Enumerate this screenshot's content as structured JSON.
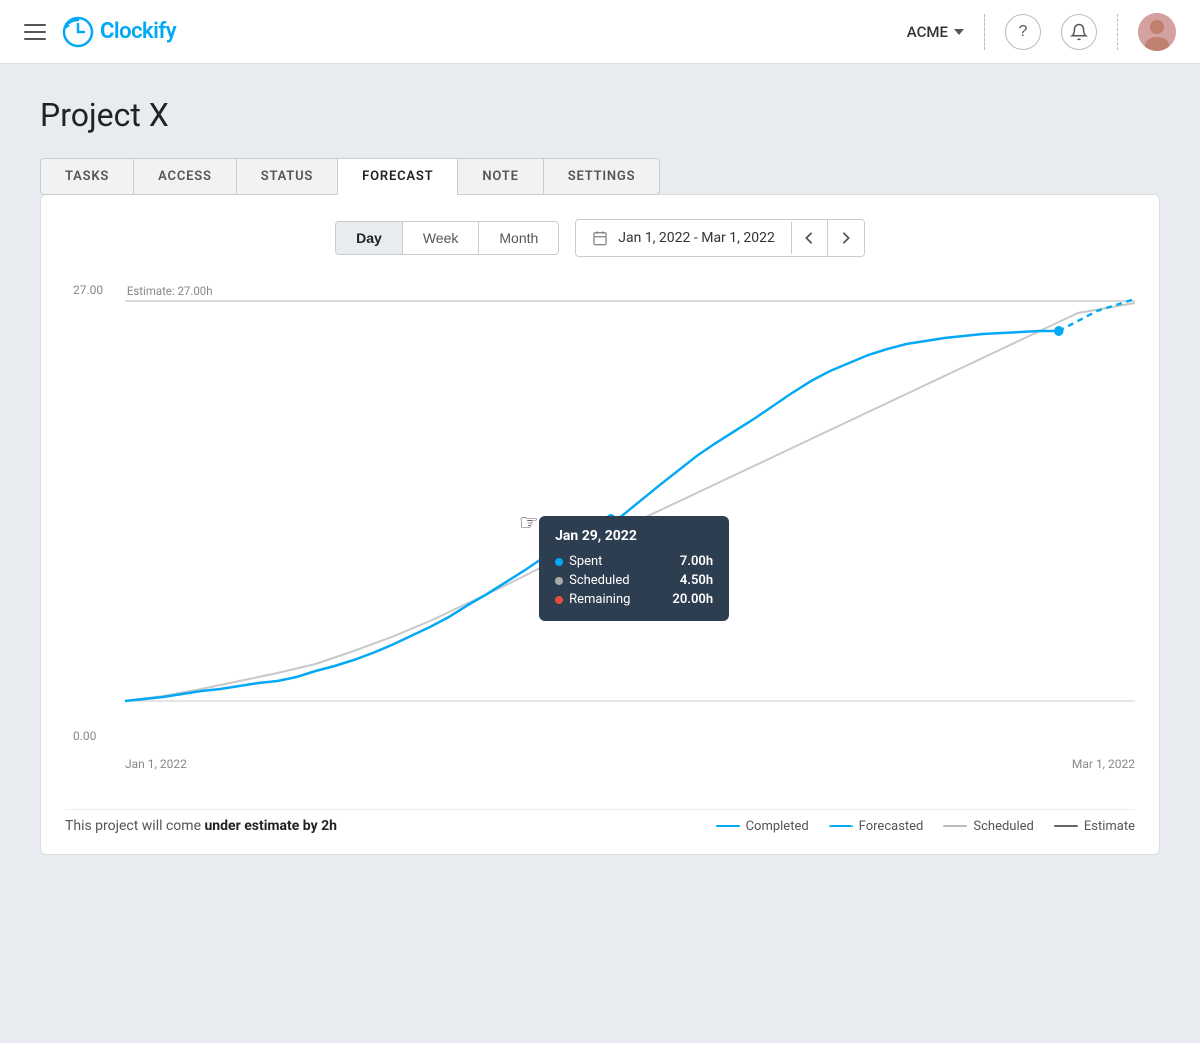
{
  "app": {
    "logo_text": "lockify",
    "workspace": "ACME"
  },
  "header": {
    "help_label": "?",
    "notification_label": "🔔"
  },
  "project": {
    "title": "Project X"
  },
  "tabs": {
    "items": [
      {
        "id": "tasks",
        "label": "TASKS"
      },
      {
        "id": "access",
        "label": "ACCESS"
      },
      {
        "id": "status",
        "label": "STATUS"
      },
      {
        "id": "forecast",
        "label": "FORECAST",
        "active": true
      },
      {
        "id": "note",
        "label": "NOTE"
      },
      {
        "id": "settings",
        "label": "SETTINGS"
      }
    ]
  },
  "chart": {
    "period_buttons": [
      {
        "id": "day",
        "label": "Day",
        "active": true
      },
      {
        "id": "week",
        "label": "Week",
        "active": false
      },
      {
        "id": "month",
        "label": "Month",
        "active": false
      }
    ],
    "date_range": "Jan 1, 2022 - Mar 1, 2022",
    "y_top": "27.00",
    "y_bottom": "0.00",
    "estimate_label": "Estimate: 27.00h",
    "x_left": "Jan 1, 2022",
    "x_right": "Mar 1, 2022",
    "tooltip": {
      "date": "Jan 29, 2022",
      "rows": [
        {
          "id": "spent",
          "label": "Spent",
          "value": "7.00h",
          "dot": "blue"
        },
        {
          "id": "scheduled",
          "label": "Scheduled",
          "value": "4.50h",
          "dot": "gray"
        },
        {
          "id": "remaining",
          "label": "Remaining",
          "value": "20.00h",
          "dot": "red"
        }
      ]
    },
    "footer": {
      "summary_prefix": "This project will come ",
      "summary_bold": "under estimate by 2h",
      "legend": [
        {
          "id": "completed",
          "label": "Completed",
          "style": "solid-blue"
        },
        {
          "id": "forecasted",
          "label": "Forecasted",
          "style": "dashed-blue"
        },
        {
          "id": "scheduled",
          "label": "Scheduled",
          "style": "solid-gray"
        },
        {
          "id": "estimate",
          "label": "Estimate",
          "style": "solid-dark"
        }
      ]
    }
  }
}
